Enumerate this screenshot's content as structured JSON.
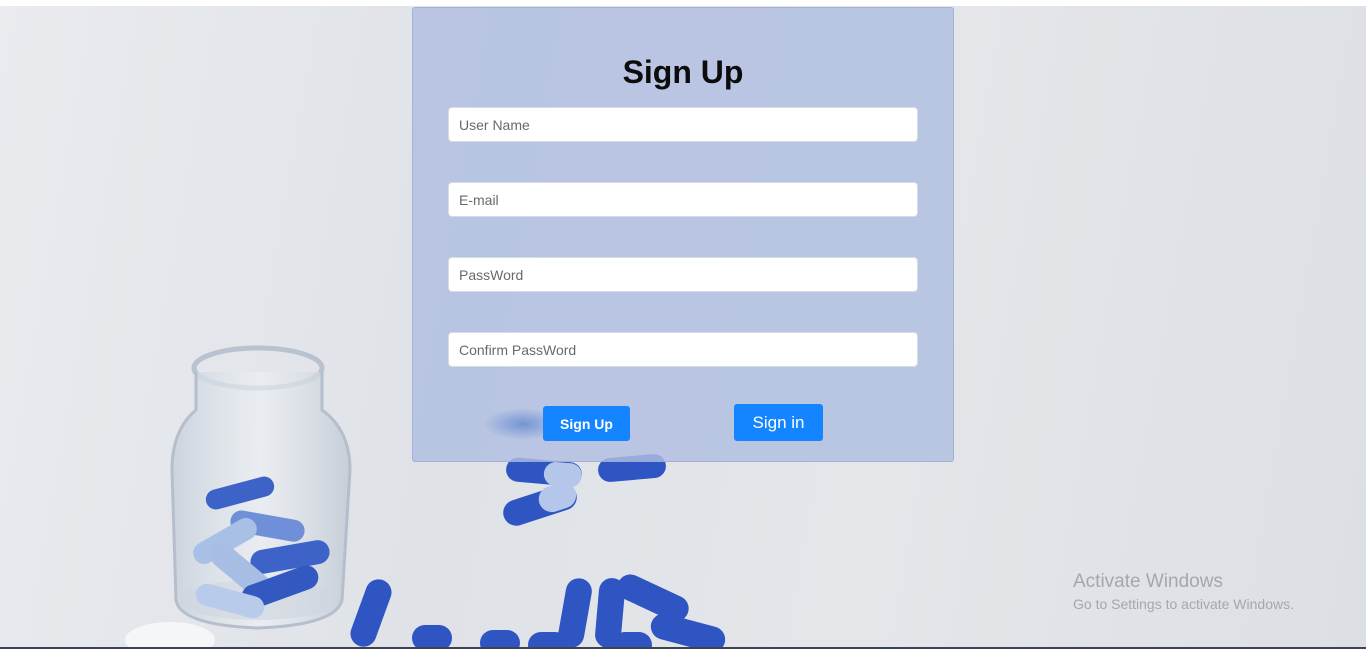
{
  "form": {
    "title": "Sign Up",
    "fields": {
      "username_placeholder": "User Name",
      "email_placeholder": "E-mail",
      "password_placeholder": "PassWord",
      "confirm_password_placeholder": "Confirm PassWord"
    },
    "signup_label": "Sign Up",
    "signin_label": "Sign in",
    "button_color": "#1485ff"
  },
  "background": {
    "description_icon": "pill-jar-photo"
  },
  "watermark": {
    "title": "Activate Windows",
    "subtitle": "Go to Settings to activate Windows."
  }
}
